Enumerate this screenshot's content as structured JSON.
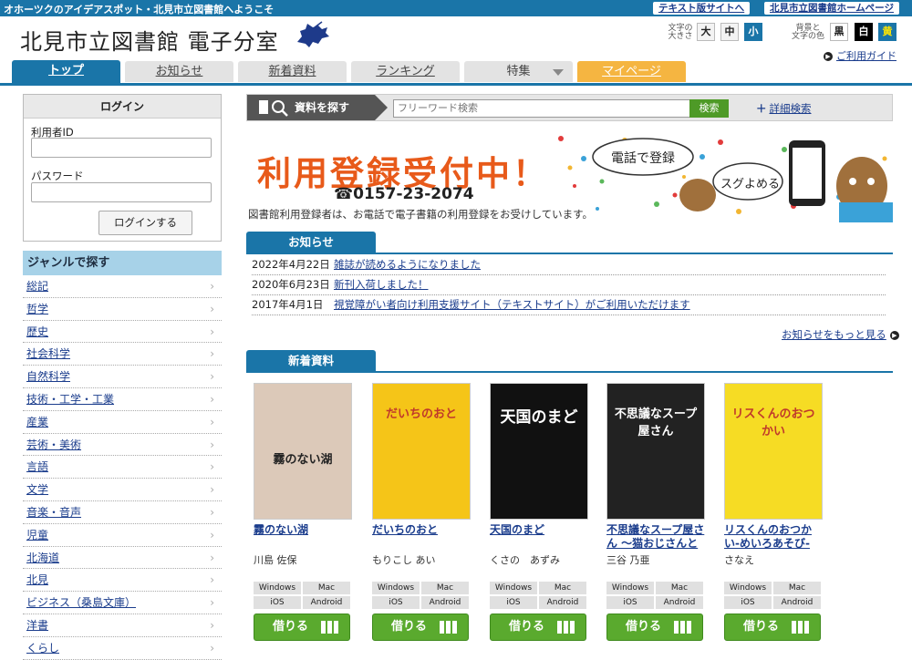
{
  "topbar": {
    "welcome": "オホーツクのアイデアスポット・北見市立図書館へようこそ",
    "text_site": "テキスト版サイトへ",
    "library_home": "北見市立図書館ホームページ"
  },
  "header": {
    "logo_text": "北見市立図書館 電子分室",
    "font_size_label_1": "文字の",
    "font_size_label_2": "大きさ",
    "size_large": "大",
    "size_medium": "中",
    "size_small": "小",
    "color_label_1": "背景と",
    "color_label_2": "文字の色",
    "color_black": "黒",
    "color_white": "白",
    "color_yellow": "黄",
    "guide": "ご利用ガイド"
  },
  "tabs": [
    {
      "label": "トップ"
    },
    {
      "label": "お知らせ"
    },
    {
      "label": "新着資料"
    },
    {
      "label": "ランキング"
    },
    {
      "label": "特集"
    },
    {
      "label": "マイページ"
    }
  ],
  "login": {
    "title": "ログイン",
    "user_id_label": "利用者ID",
    "password_label": "パスワード",
    "button": "ログインする"
  },
  "genre": {
    "title": "ジャンルで探す",
    "items": [
      "総記",
      "哲学",
      "歴史",
      "社会科学",
      "自然科学",
      "技術・工学・工業",
      "産業",
      "芸術・美術",
      "言語",
      "文学",
      "音楽・音声",
      "児童",
      "北海道",
      "北見",
      "ビジネス（桑島文庫）",
      "洋書",
      "くらし"
    ]
  },
  "search": {
    "label": "資料を探す",
    "placeholder": "フリーワード検索",
    "button": "検索",
    "advanced": "詳細検索"
  },
  "banner": {
    "headline": "利用登録受付中！",
    "phone": "☎0157-23-2074",
    "caption": "図書館利用登録者は、お電話で電子書籍の利用登録をお受けしています。",
    "bubble_1": "電話で登録",
    "bubble_2": "スグよめる"
  },
  "news": {
    "heading": "お知らせ",
    "items": [
      {
        "date": "2022年4月22日",
        "title": "雑誌が読めるようになりました"
      },
      {
        "date": "2020年6月23日",
        "title": "新刊入荷しました！"
      },
      {
        "date": "2017年4月1日",
        "title": "視覚障がい者向け利用支援サイト（テキストサイト）がご利用いただけます"
      }
    ],
    "more": "お知らせをもっと見る"
  },
  "new_arrivals": {
    "heading": "新着資料",
    "os_labels": [
      "Windows",
      "Mac",
      "iOS",
      "Android"
    ],
    "borrow_label": "借りる",
    "books": [
      {
        "title": "霧のない湖",
        "author": "川島 佐保",
        "cover_text": "霧のない湖",
        "cover_color": "#dcc9b9"
      },
      {
        "title": "だいちのおと",
        "author": "もりこし あい",
        "cover_text": "だいちのおと",
        "cover_color": "#f5c518"
      },
      {
        "title": "天国のまど",
        "author": "くさの　あずみ",
        "cover_text": "天国のまど",
        "cover_color": "#111111"
      },
      {
        "title": "不思議なスープ屋さん ～猫おじさんと",
        "author": "三谷 乃亜",
        "cover_text": "不思議なスープ屋さん",
        "cover_color": "#222222"
      },
      {
        "title": "リスくんのおつかい-めいろあそび-",
        "author": "さなえ",
        "cover_text": "リスくんのおつかい",
        "cover_color": "#f6dc24"
      }
    ]
  },
  "colors": {
    "primary": "#1a75a8",
    "genre_header": "#a7d2e8",
    "mypage_tab": "#f5b541",
    "borrow_green": "#5aaa2e"
  }
}
